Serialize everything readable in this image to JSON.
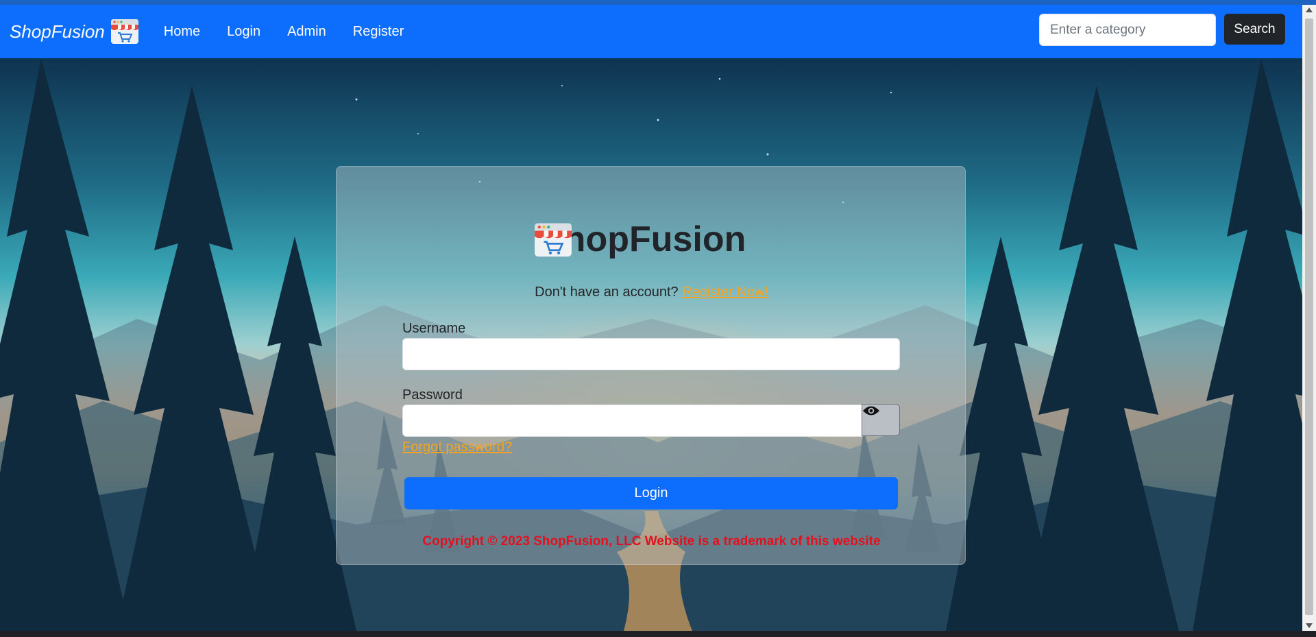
{
  "navbar": {
    "brand": "ShopFusion",
    "links": [
      "Home",
      "Login",
      "Admin",
      "Register"
    ],
    "search_placeholder": "Enter a category",
    "search_label": "Search"
  },
  "login_card": {
    "title": "ShopFusion",
    "register_prompt": "Don't have an account?",
    "register_link": "Register Now!",
    "username_label": "Username",
    "username_value": "",
    "password_label": "Password",
    "password_value": "",
    "forgot_link": "Forgot password?",
    "login_label": "Login",
    "copyright": "Copyright © 2023 ShopFusion, LLC Website is a trademark of this website"
  },
  "colors": {
    "primary": "#0d6efd",
    "link": "#f4a523",
    "copyright": "#e3101e",
    "dark_button": "#212529"
  },
  "icons": [
    "shop-logo-icon",
    "eye-icon"
  ]
}
